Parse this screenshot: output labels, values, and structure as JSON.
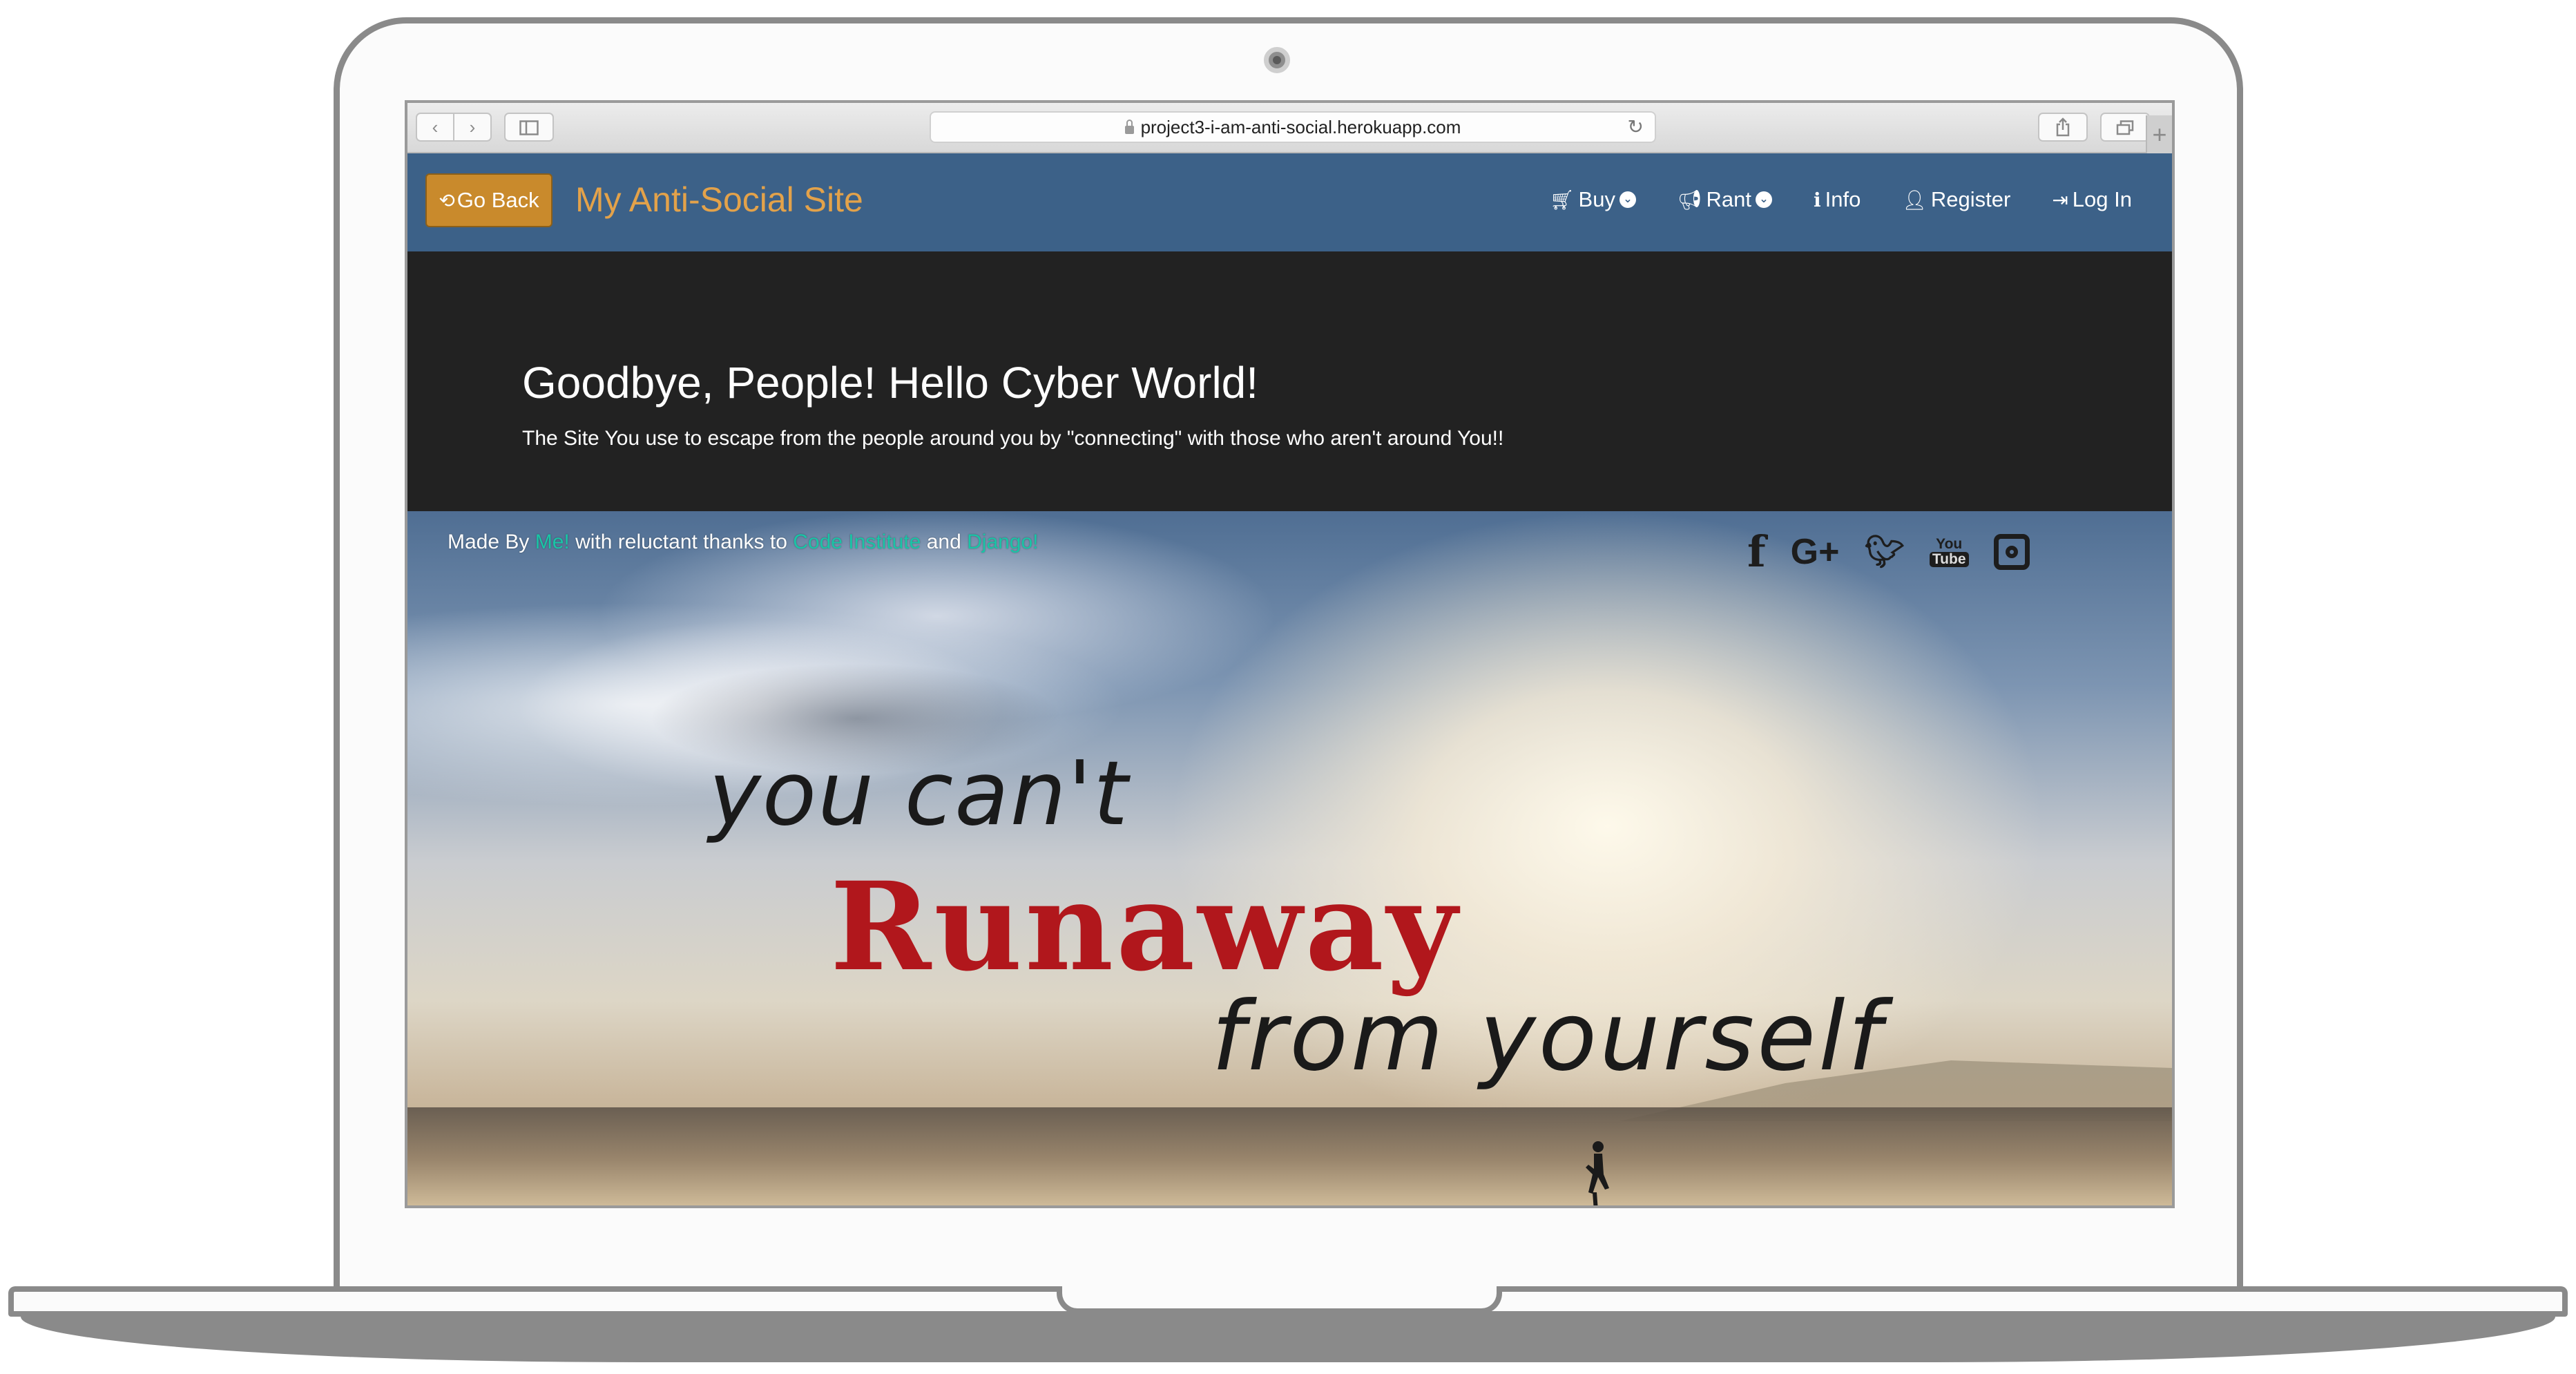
{
  "browser": {
    "url": "project3-i-am-anti-social.herokuapp.com",
    "back_glyph": "‹",
    "forward_glyph": "›",
    "reload_glyph": "↻",
    "add_tab_glyph": "+"
  },
  "navbar": {
    "go_back_label": "Go Back",
    "go_back_icon": "⟲",
    "brand": "My Anti-Social Site",
    "items": [
      {
        "label": "Buy",
        "icon": "basket-icon",
        "glyph": "🛒︎",
        "dropdown": true
      },
      {
        "label": "Rant",
        "icon": "bullhorn-icon",
        "glyph": "📢︎",
        "dropdown": true
      },
      {
        "label": "Info",
        "icon": "info-icon",
        "glyph": "ℹ",
        "dropdown": false
      },
      {
        "label": "Register",
        "icon": "user-plus-icon",
        "glyph": "👤︎",
        "dropdown": false
      },
      {
        "label": "Log In",
        "icon": "sign-in-icon",
        "glyph": "⇥",
        "dropdown": false
      }
    ],
    "dropdown_glyph": "⌄"
  },
  "hero": {
    "title": "Goodbye, People! Hello Cyber World!",
    "subtitle": "The Site You use to escape from the people around you by \"connecting\" with those who aren't around You!!"
  },
  "footer": {
    "made_by": "Made By ",
    "me_link": "Me!",
    "thanks": " with reluctant thanks to ",
    "ci_link": "Code Institute",
    "and": " and ",
    "django_link": "Django!"
  },
  "social": {
    "facebook": "f",
    "google_plus": "G+",
    "twitter": "🐦︎",
    "youtube_top": "You",
    "youtube_bottom": "Tube"
  },
  "quote": {
    "line1": "you can't",
    "line2": "Runaway",
    "line3": "from yourself"
  },
  "colors": {
    "navbar": "#3c6188",
    "go_back": "#c98a2c",
    "brand": "#e3a24a",
    "hero_bg": "#222222",
    "link": "#19c5a6",
    "runaway": "#b1171c"
  }
}
